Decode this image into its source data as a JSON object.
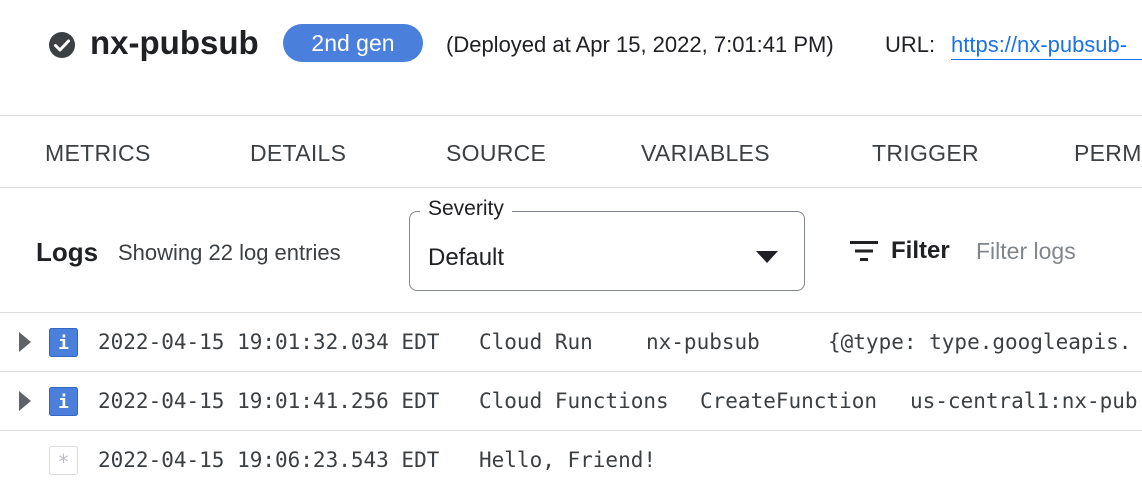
{
  "header": {
    "function_name": "nx-pubsub",
    "status_icon": "check-circle-icon",
    "generation_badge": "2nd gen",
    "deployed_text": "(Deployed at Apr 15, 2022, 7:01:41 PM)",
    "url_label": "URL:",
    "url_text": "https://nx-pubsub-",
    "colors": {
      "badge": "#4a7fdc",
      "link": "#1a73e8",
      "status_icon": "#3c4043"
    }
  },
  "tabs": [
    "METRICS",
    "DETAILS",
    "SOURCE",
    "VARIABLES",
    "TRIGGER",
    "PERM"
  ],
  "logs": {
    "title": "Logs",
    "count_text": "Showing 22 log entries",
    "severity": {
      "label": "Severity",
      "value": "Default",
      "icon": "dropdown-arrow-icon"
    },
    "filter": {
      "label": "Filter",
      "icon": "filter-icon",
      "placeholder": "Filter logs"
    },
    "entries": [
      {
        "severity": "info",
        "expandable": true,
        "timestamp": "2022-04-15 19:01:32.034 EDT",
        "col1": "Cloud Run",
        "col2": "nx-pubsub",
        "col3": "{@type: type.googleapis."
      },
      {
        "severity": "info",
        "expandable": true,
        "timestamp": "2022-04-15 19:01:41.256 EDT",
        "col1": "Cloud Functions",
        "col2": "CreateFunction",
        "col3": "us-central1:nx-pub"
      },
      {
        "severity": "default",
        "expandable": false,
        "timestamp": "2022-04-15 19:06:23.543 EDT",
        "col1": "Hello, Friend!",
        "col2": "",
        "col3": ""
      }
    ],
    "colors": {
      "info_icon": "#4a7fdc",
      "default_icon": "#bdc1c6"
    }
  }
}
